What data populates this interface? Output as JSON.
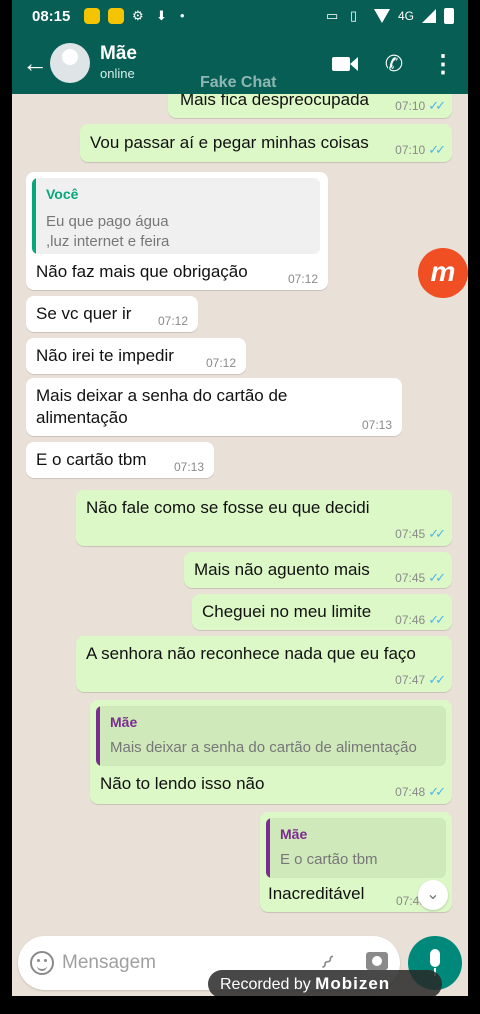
{
  "status_bar": {
    "time": "08:15",
    "network": "4G"
  },
  "header": {
    "contact_name": "Mãe",
    "contact_status": "online",
    "app_label": "Fake Chat"
  },
  "messages": [
    {
      "dir": "out",
      "text": "Mais fica despreocupada",
      "time": "07:10",
      "ticks": "✓✓"
    },
    {
      "dir": "out",
      "text": "Vou passar aí e pegar minhas coisas",
      "time": "07:10",
      "ticks": "✓✓"
    },
    {
      "dir": "in",
      "quote_author": "Você",
      "quote_line1": "Eu que pago água",
      "quote_line2": ",luz internet e feira",
      "text": "Não faz mais que obrigação",
      "time": "07:12"
    },
    {
      "dir": "in",
      "text": "Se vc quer ir",
      "time": "07:12"
    },
    {
      "dir": "in",
      "text": "Não irei te impedir",
      "time": "07:12"
    },
    {
      "dir": "in",
      "text_line1": "Mais deixar a senha do cartão de",
      "text_line2": "alimentação",
      "time": "07:13"
    },
    {
      "dir": "in",
      "text": "E o cartão tbm",
      "time": "07:13"
    },
    {
      "dir": "out",
      "text": "Não fale como se fosse eu que decidi",
      "time": "07:45",
      "ticks": "✓✓"
    },
    {
      "dir": "out",
      "text": "Mais não aguento mais",
      "time": "07:45",
      "ticks": "✓✓"
    },
    {
      "dir": "out",
      "text": "Cheguei no meu limite",
      "time": "07:46",
      "ticks": "✓✓"
    },
    {
      "dir": "out",
      "text": "A senhora não reconhece nada que eu faço",
      "time": "07:47",
      "ticks": "✓✓"
    },
    {
      "dir": "out",
      "quote_author": "Mãe",
      "quote_line1": "Mais deixar a senha do cartão de alimentação",
      "text": "Não to lendo isso não",
      "time": "07:48",
      "ticks": "✓✓"
    },
    {
      "dir": "out",
      "quote_author": "Mãe",
      "quote_line1": "E o cartão tbm",
      "text": "Inacreditável",
      "time": "07:48"
    }
  ],
  "composer": {
    "placeholder": "Mensagem"
  },
  "overlay": {
    "recorder_prefix": "Recorded by",
    "recorder_brand": "Mobizen",
    "recorder_logo": "m"
  },
  "colors": {
    "header": "#075e54",
    "outgoing": "#dcf8c6",
    "incoming": "#ffffff",
    "quote_you": "#06a77d",
    "quote_mom": "#7b2c8f",
    "read_ticks": "#4fb6ec"
  }
}
